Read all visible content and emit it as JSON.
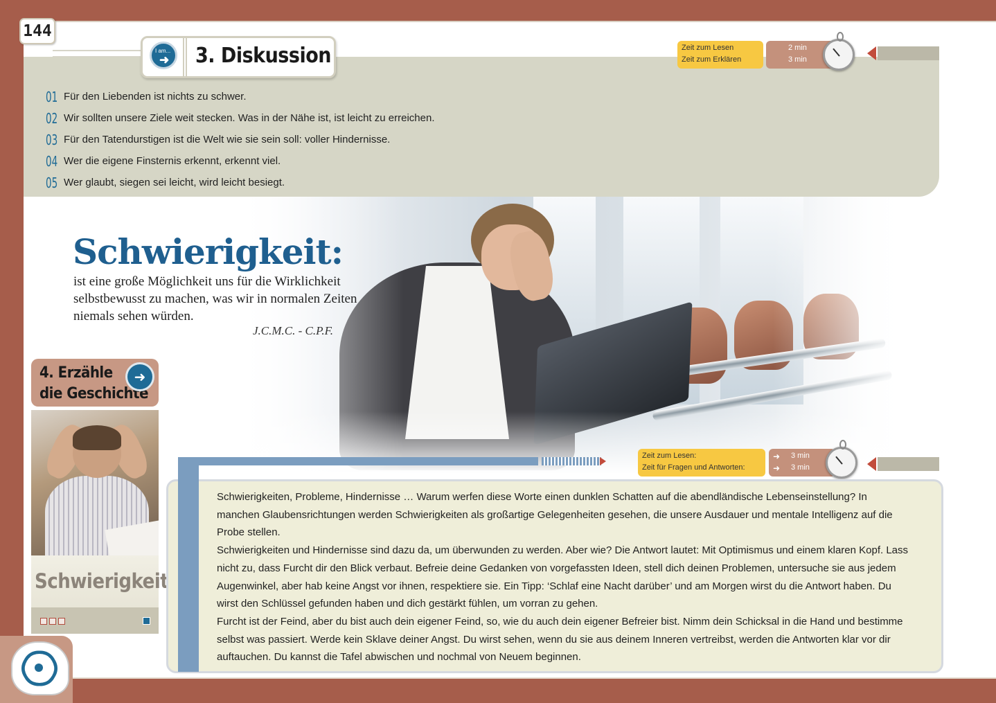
{
  "page": {
    "number": "144"
  },
  "section3": {
    "icon_text": "I am...",
    "title": "3. Diskussion",
    "timer": {
      "labels": [
        "Zeit zum Lesen",
        "Zeit zum Erklären"
      ],
      "values": [
        "2 min",
        "3 min"
      ]
    },
    "items": [
      {
        "num": "01",
        "text": "Für den Liebenden ist nichts zu schwer."
      },
      {
        "num": "02",
        "text": "Wir sollten unsere Ziele weit stecken. Was in der Nähe ist, ist leicht zu erreichen."
      },
      {
        "num": "03",
        "text": "Für den Tatendurstigen ist die Welt wie sie sein soll: voller Hindernisse."
      },
      {
        "num": "04",
        "text": "Wer die eigene Finsternis erkennt, erkennt viel."
      },
      {
        "num": "05",
        "text": "Wer glaubt, siegen sei leicht, wird leicht besiegt."
      }
    ]
  },
  "quote": {
    "title": "Schwierigkeit:",
    "text": "ist eine große Möglichkeit uns für die Wirklichkeit selbstbewusst zu machen, was wir in normalen Zeiten niemals sehen würden.",
    "author": "J.C.M.C. - C.P.F."
  },
  "section4": {
    "title_line1": "4. Erzähle",
    "title_line2": "die Geschichte",
    "card_title": "Schwierigkeit",
    "timer": {
      "labels": [
        "Zeit zum Lesen:",
        "Zeit für Fragen und Antworten:"
      ],
      "values": [
        "3 min",
        "3 min"
      ]
    },
    "paragraphs": [
      "Schwierigkeiten, Probleme, Hindernisse … Warum werfen diese Worte einen dunklen Schatten auf die abendländische Lebenseinstellung? In manchen Glaubensrichtungen werden Schwierigkeiten als großartige Gelegenheiten gesehen, die unsere Ausdauer und mentale Intelligenz auf die Probe stellen.",
      "Schwierigkeiten und Hindernisse sind dazu da, um überwunden zu werden. Aber wie? Die Antwort lautet: Mit Optimismus und einem klaren Kopf. Lass nicht zu, dass Furcht dir den Blick verbaut. Befreie deine Gedanken von vorgefassten Ideen, stell dich deinen Problemen, untersuche sie aus jedem Augenwinkel, aber hab keine Angst vor ihnen, respektiere sie. Ein Tipp: ‘Schlaf eine Nacht darüber’ und am Morgen wirst du die Antwort haben. Du wirst den Schlüssel gefunden haben und dich gestärkt fühlen, um vorran zu gehen.",
      "Furcht ist der Feind, aber du bist auch dein eigener Feind, so, wie du auch dein eigener Befreier bist. Nimm dein Schicksal in die Hand und bestimme selbst was passiert. Werde kein Sklave deiner Angst. Du wirst sehen, wenn du sie aus deinem Inneren vertreibst, werden die Antworten klar vor dir auftauchen. Du kannst die Tafel abwischen und nochmal von Neuem beginnen."
    ]
  },
  "icons": {
    "section3": "speech-arrow-icon",
    "section4": "story-arrow-icon",
    "timer": "stopwatch-icon",
    "corner": "brain-atom-icon"
  },
  "colors": {
    "frame": "#a65d4b",
    "accent_blue": "#1f6b96",
    "panel_grey": "#d6d6c6",
    "text_panel": "#efeed9",
    "timer_yellow": "#f7c842",
    "timer_brown": "#c4917c"
  }
}
